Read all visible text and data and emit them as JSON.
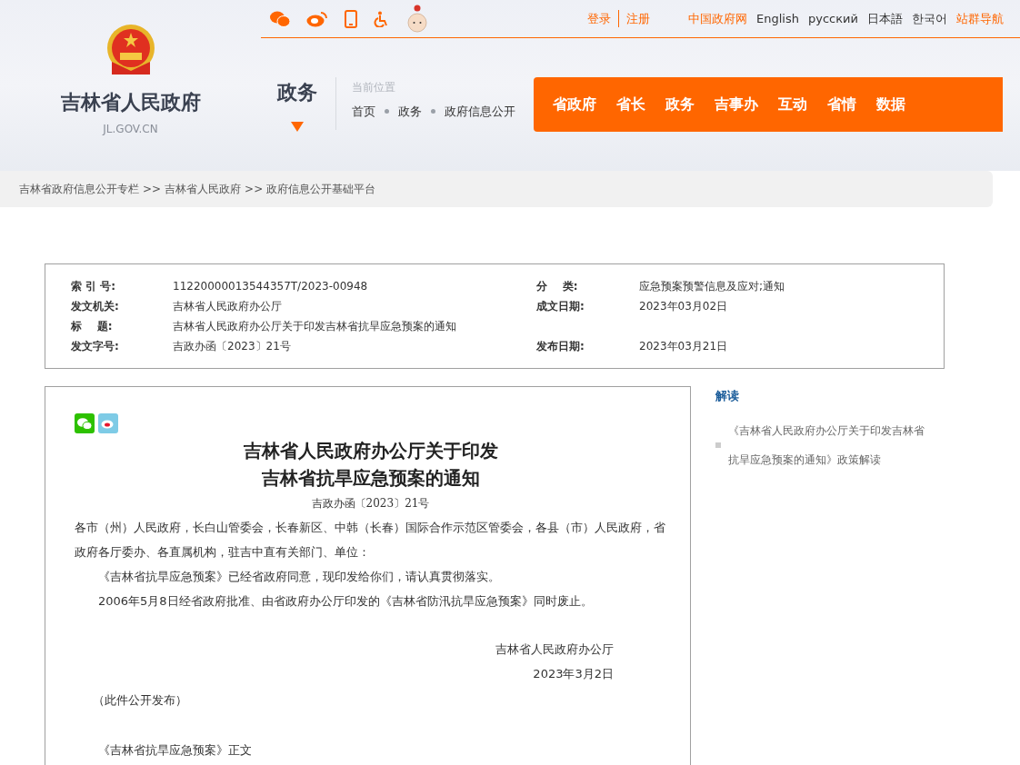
{
  "header": {
    "site_name": "吉林省人民政府",
    "domain": "JL.GOV.CN",
    "top_links": [
      {
        "label": "登录",
        "kind": "accent"
      },
      {
        "label": "注册",
        "kind": "accent"
      },
      {
        "label": "中国政府网",
        "kind": "accent"
      },
      {
        "label": "English",
        "kind": "plain"
      },
      {
        "label": "русский",
        "kind": "plain"
      },
      {
        "label": "日本語",
        "kind": "plain"
      },
      {
        "label": "한국어",
        "kind": "plain"
      },
      {
        "label": "站群导航",
        "kind": "accent"
      }
    ],
    "section": "政务",
    "location_label": "当前位置",
    "location": [
      "首页",
      "政务",
      "政府信息公开"
    ],
    "nav": [
      "省政府",
      "省长",
      "政务",
      "吉事办",
      "互动",
      "省情",
      "数据"
    ]
  },
  "breadcrumb": [
    "吉林省政府信息公开专栏",
    ">>",
    "吉林省人民政府",
    ">>",
    "政府信息公开基础平台"
  ],
  "meta": [
    {
      "label": "索 引 号:",
      "value": "11220000013544357T/2023-00948",
      "label2": "分    类:",
      "value2": "应急预案预警信息及应对;通知"
    },
    {
      "label": "发文机关:",
      "value": "吉林省人民政府办公厅",
      "label2": "成文日期:",
      "value2": "2023年03月02日"
    },
    {
      "label": "标    题:",
      "value": "吉林省人民政府办公厅关于印发吉林省抗旱应急预案的通知"
    },
    {
      "label": "发文字号:",
      "value": "吉政办函〔2023〕21号",
      "label2": "发布日期:",
      "value2": "2023年03月21日"
    }
  ],
  "article": {
    "title_lines": [
      "吉林省人民政府办公厅关于印发",
      "吉林省抗旱应急预案的通知"
    ],
    "doc_number": "吉政办函〔2023〕21号",
    "addressee": "各市（州）人民政府，长白山管委会，长春新区、中韩（长春）国际合作示范区管委会，各县（市）人民政府，省政府各厅委办、各直属机构，驻吉中直有关部门、单位：",
    "paragraphs": [
      "《吉林省抗旱应急预案》已经省政府同意，现印发给你们，请认真贯彻落实。",
      "2006年5月8日经省政府批准、由省政府办公厅印发的《吉林省防汛抗旱应急预案》同时废止。"
    ],
    "signer": "吉林省人民政府办公厅",
    "date": "2023年3月2日",
    "note": "（此件公开发布）",
    "attachment": "《吉林省抗旱应急预案》正文"
  },
  "sidebar": {
    "title": "解读",
    "items": [
      "《吉林省人民政府办公厅关于印发吉林省抗旱应急预案的通知》政策解读"
    ]
  }
}
